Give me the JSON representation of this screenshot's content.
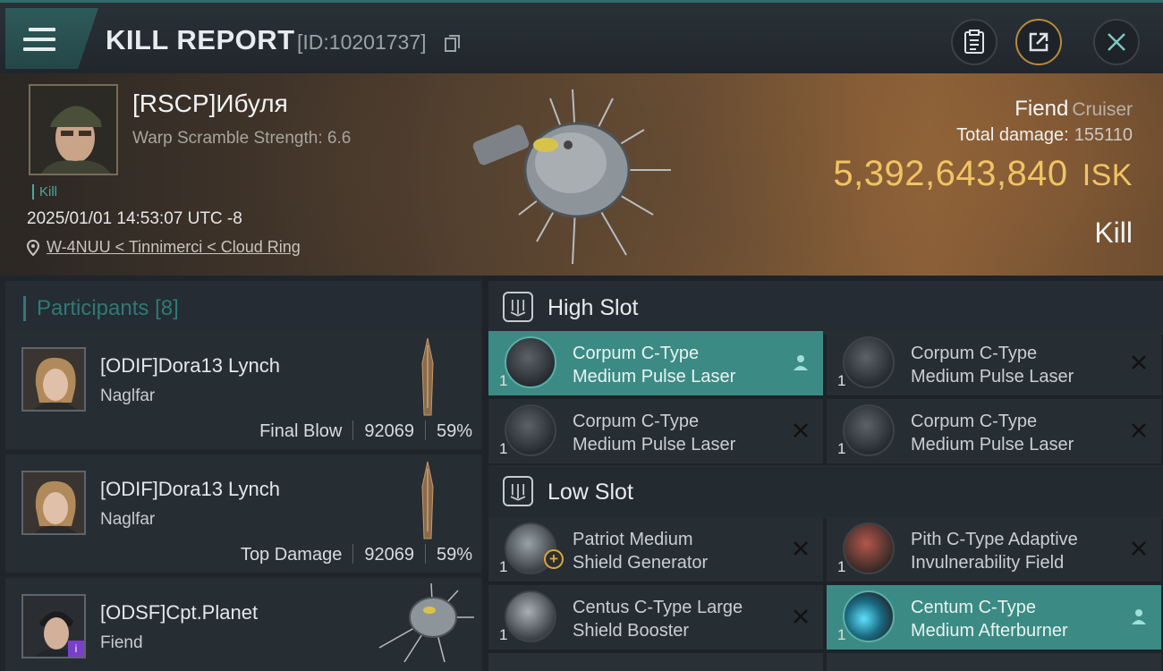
{
  "header": {
    "title": "KILL REPORT",
    "report_id": "[ID:10201737]",
    "icons": [
      "menu-icon",
      "copy-icon",
      "clipboard-icon",
      "share-icon",
      "close-icon"
    ]
  },
  "victim": {
    "name": "[RSCP]Ибуля",
    "warp_scramble": "Warp Scramble Strength: 6.6",
    "tag": "Kill",
    "datetime": "2025/01/01 14:53:07 UTC -8",
    "location": "W-4NUU < Tinnimerci < Cloud Ring",
    "ship_name": "Fiend",
    "ship_class": "Cruiser",
    "total_damage_label": "Total damage:",
    "total_damage": "155110",
    "isk_value": "5,392,643,840",
    "isk_unit": "ISK",
    "result": "Kill"
  },
  "participants": {
    "label": "Participants",
    "count": "[8]",
    "rows": [
      {
        "name": "[ODIF]Dora13 Lynch",
        "ship": "Naglfar",
        "role": "Final Blow",
        "damage": "92069",
        "percent": "59%"
      },
      {
        "name": "[ODIF]Dora13 Lynch",
        "ship": "Naglfar",
        "role": "Top Damage",
        "damage": "92069",
        "percent": "59%"
      },
      {
        "name": "[ODSF]Cpt.Planet",
        "ship": "Fiend",
        "role": "",
        "damage": "",
        "percent": ""
      }
    ]
  },
  "slots": {
    "high_label": "High Slot",
    "low_label": "Low Slot",
    "high": [
      {
        "line1": "Corpum C-Type",
        "line2": "Medium Pulse Laser",
        "qty": "1",
        "state": "dropped"
      },
      {
        "line1": "Corpum C-Type",
        "line2": "Medium Pulse Laser",
        "qty": "1",
        "state": "destroyed"
      },
      {
        "line1": "Corpum C-Type",
        "line2": "Medium Pulse Laser",
        "qty": "1",
        "state": "destroyed"
      },
      {
        "line1": "Corpum C-Type",
        "line2": "Medium Pulse Laser",
        "qty": "1",
        "state": "destroyed"
      }
    ],
    "low": [
      {
        "line1": "Patriot Medium",
        "line2": "Shield Generator",
        "qty": "1",
        "state": "destroyed"
      },
      {
        "line1": "Pith C-Type Adaptive",
        "line2": "Invulnerability Field",
        "qty": "1",
        "state": "destroyed"
      },
      {
        "line1": "Centus C-Type Large",
        "line2": "Shield Booster",
        "qty": "1",
        "state": "destroyed"
      },
      {
        "line1": "Centum C-Type",
        "line2": "Medium Afterburner",
        "qty": "1",
        "state": "dropped"
      }
    ]
  },
  "colors": {
    "accent": "#3b8b84",
    "isk": "#f0c463",
    "teal_text": "#2f7a76"
  }
}
